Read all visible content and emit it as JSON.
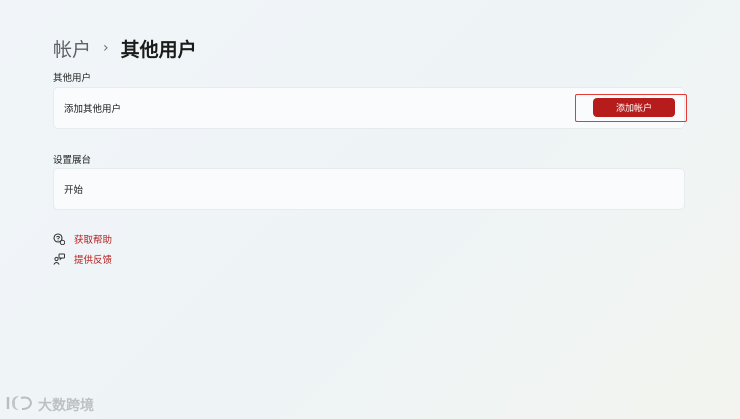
{
  "breadcrumb": {
    "parent": "帐户",
    "separator": "›",
    "current": "其他用户"
  },
  "other_users": {
    "section_label": "其他用户",
    "add_text": "添加其他用户",
    "add_button": "添加帐户"
  },
  "kiosk": {
    "section_label": "设置展台",
    "start_text": "开始"
  },
  "links": {
    "help": "获取帮助",
    "feedback": "提供反馈"
  },
  "watermark": {
    "text": "大数跨境"
  },
  "colors": {
    "accent": "#b71c1c",
    "highlight_border": "#e53935"
  },
  "icons": {
    "help": "help-chat-icon",
    "feedback": "feedback-icon"
  }
}
